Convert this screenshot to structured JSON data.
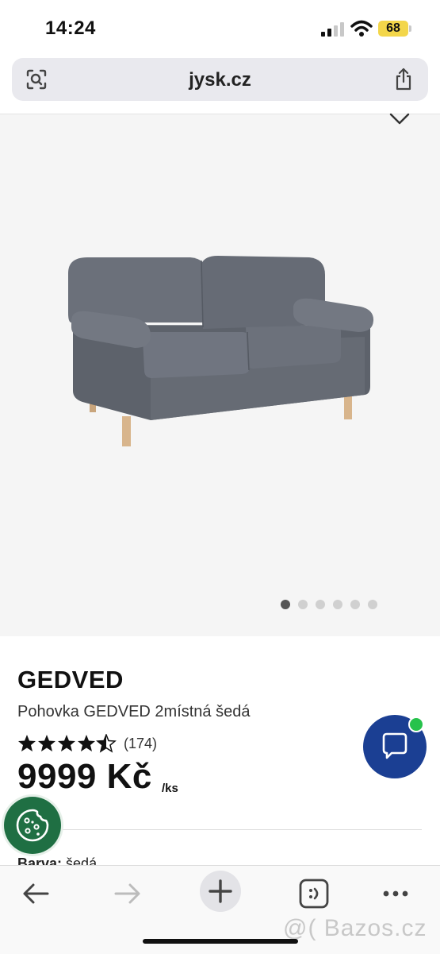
{
  "status_bar": {
    "time": "14:24",
    "battery": "68",
    "icons": [
      "cellular-signal-icon",
      "wifi-icon",
      "battery-icon"
    ],
    "battery_color": "#f3d64a"
  },
  "browser": {
    "url": "jysk.cz",
    "left_icon": "visual-lookup-icon",
    "right_icon": "share-icon"
  },
  "gallery": {
    "image": "grey two-seater sofa with wooden legs",
    "heart_icon": "wishlist-heart-icon",
    "dot_count": 6,
    "active_index": 0
  },
  "product": {
    "brand": "GEDVED",
    "name": "Pohovka GEDVED 2místná šedá",
    "rating": 4.5,
    "rating_count": "(174)",
    "price": "9999 Kč",
    "unit": "/ks",
    "color_label": "Barva:",
    "color_value": "šedá"
  },
  "chat": {
    "icon": "chat-bubble-icon",
    "color": "#1b3f93",
    "status_color": "#26c24b"
  },
  "cookie": {
    "icon": "cookie-icon",
    "color": "#1f6f43"
  },
  "toolbar": {
    "buttons": [
      "back-arrow-icon",
      "forward-arrow-icon",
      "new-tab-plus-icon",
      "tabs-icon",
      "more-icon"
    ]
  },
  "watermark": "@( Bazos.cz"
}
